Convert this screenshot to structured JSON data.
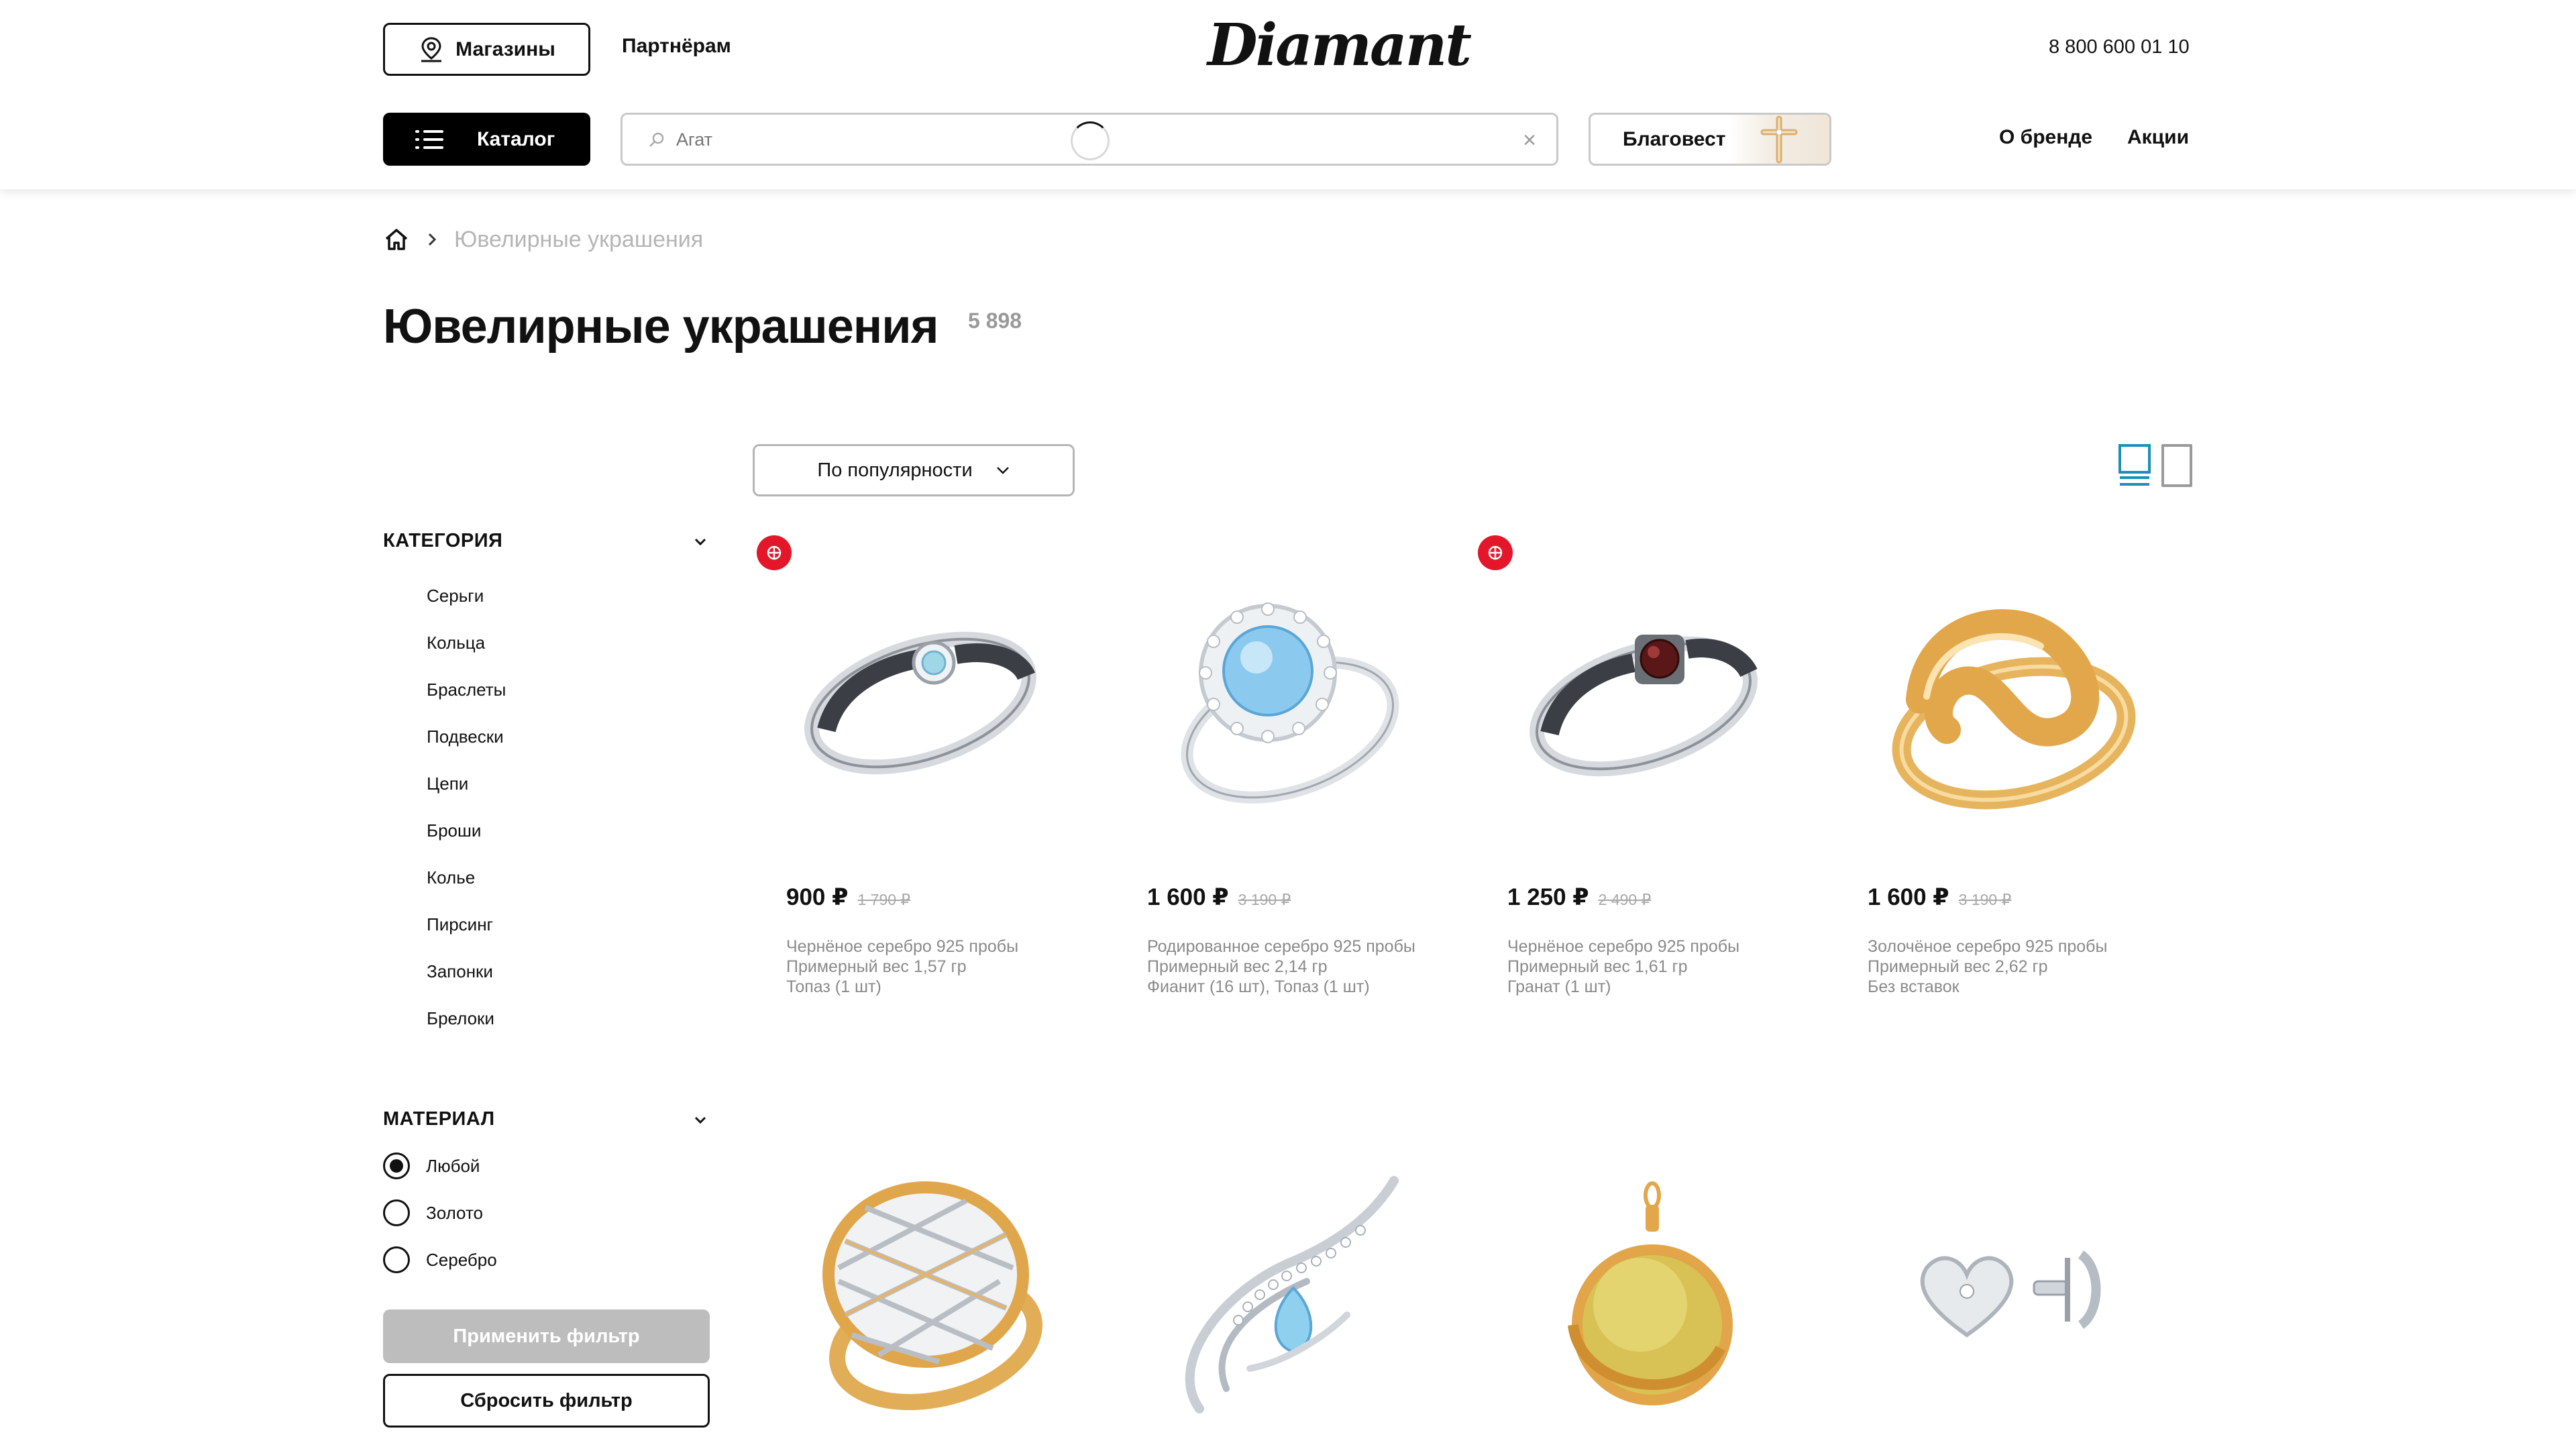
{
  "header": {
    "stores_label": "Магазины",
    "partners_label": "Партнёрам",
    "logo_text": "Diamant",
    "phone": "8 800 600 01 10",
    "catalog_label": "Каталог",
    "search_placeholder": "Агат",
    "blagovest_label": "Благовест",
    "nav_about": "О бренде",
    "nav_sales": "Акции"
  },
  "breadcrumb": {
    "current": "Ювелирные украшения"
  },
  "page": {
    "title": "Ювелирные украшения",
    "count": "5 898"
  },
  "sort": {
    "label": "По популярности"
  },
  "filters": {
    "category_title": "КАТЕГОРИЯ",
    "categories": [
      "Серьги",
      "Кольца",
      "Браслеты",
      "Подвески",
      "Цепи",
      "Броши",
      "Колье",
      "Пирсинг",
      "Запонки",
      "Брелоки"
    ],
    "material_title": "МАТЕРИАЛ",
    "materials": [
      "Любой",
      "Золото",
      "Серебро"
    ],
    "material_selected": "Любой",
    "apply_label": "Применить фильтр",
    "reset_label": "Сбросить фильтр"
  },
  "products": [
    {
      "price": "900 ₽",
      "old_price": "1 790 ₽",
      "line1": "Чернёное серебро 925 пробы",
      "line2": "Примерный вес 1,57 гр",
      "line3": "Топаз (1 шт)",
      "badge": true
    },
    {
      "price": "1 600 ₽",
      "old_price": "3 190 ₽",
      "line1": "Родированное серебро 925 пробы",
      "line2": "Примерный вес 2,14 гр",
      "line3": "Фианит (16 шт), Топаз (1 шт)",
      "badge": false
    },
    {
      "price": "1 250 ₽",
      "old_price": "2 490 ₽",
      "line1": "Чернёное серебро 925 пробы",
      "line2": "Примерный вес 1,61 гр",
      "line3": "Гранат (1 шт)",
      "badge": true
    },
    {
      "price": "1 600 ₽",
      "old_price": "3 190 ₽",
      "line1": "Золочёное серебро 925 пробы",
      "line2": "Примерный вес 2,62 гр",
      "line3": "Без вставок",
      "badge": false
    }
  ],
  "colors": {
    "accent": "#000000",
    "badge": "#e3162a",
    "muted": "#8a8a8a",
    "view_active": "#1a8fb8"
  }
}
